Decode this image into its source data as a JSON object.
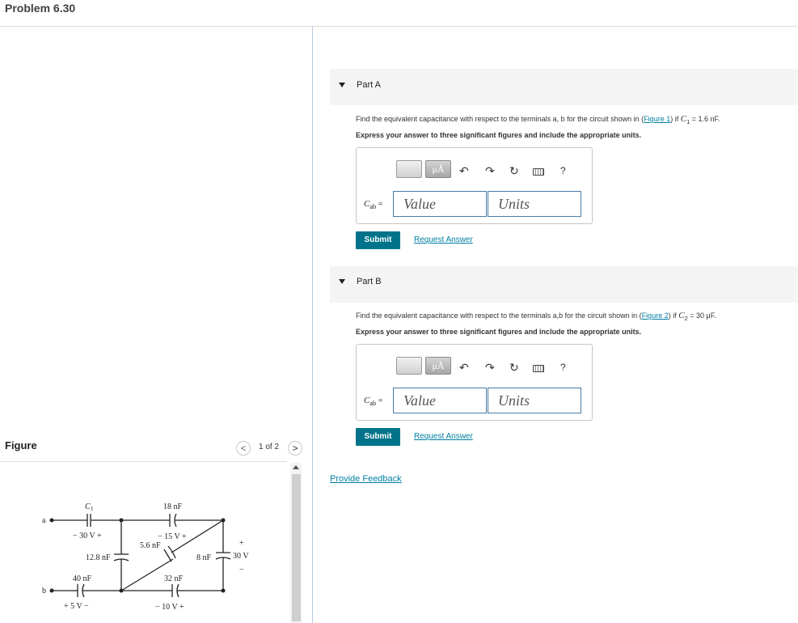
{
  "title": "Problem 6.30",
  "figure": {
    "label": "Figure",
    "pager": {
      "prev": "<",
      "next": ">",
      "count": "1 of 2"
    },
    "circuit": {
      "node_a": "a",
      "node_b": "b",
      "c1_label": "C",
      "c1_sub": "1",
      "c1_voltage": "− 30 V +",
      "c_18": "18 nF",
      "v_15": "− 15 V +",
      "c_5_6": "5.6 nF",
      "c_12_8": "12.8 nF",
      "c_8": "8 nF",
      "v_30_plus": "+",
      "v_30": "30 V",
      "v_30_minus": "−",
      "c_40": "40 nF",
      "c_32": "32 nF",
      "v_5": "+  5 V  −",
      "v_10": "−  10 V  +"
    }
  },
  "parts": [
    {
      "title": "Part A",
      "question": {
        "pre": "Find the equivalent capacitance with respect to the terminals a, b for the circuit shown in (",
        "link": "Figure 1",
        "post": ") if ",
        "var": "C",
        "sub": "1",
        "value": " = 1.6 nF."
      },
      "instruction": "Express your answer to three significant figures and include the appropriate units.",
      "toolbar": {
        "units_symbol": "μÅ",
        "help": "?"
      },
      "var_label": "C",
      "var_sub": "ab",
      "equals": "=",
      "value_placeholder": "Value",
      "units_placeholder": "Units",
      "submit": "Submit",
      "request": "Request Answer"
    },
    {
      "title": "Part B",
      "question": {
        "pre": "Find the equivalent capacitance with respect to the terminals a,b for the circuit shown in (",
        "link": "Figure 2",
        "post": ") if ",
        "var": "C",
        "sub": "2",
        "value": " = 30 μF."
      },
      "instruction": "Express your answer to three significant figures and include the appropriate units.",
      "toolbar": {
        "units_symbol": "μÅ",
        "help": "?"
      },
      "var_label": "C",
      "var_sub": "ab",
      "equals": "=",
      "value_placeholder": "Value",
      "units_placeholder": "Units",
      "submit": "Submit",
      "request": "Request Answer"
    }
  ],
  "feedback": "Provide Feedback"
}
